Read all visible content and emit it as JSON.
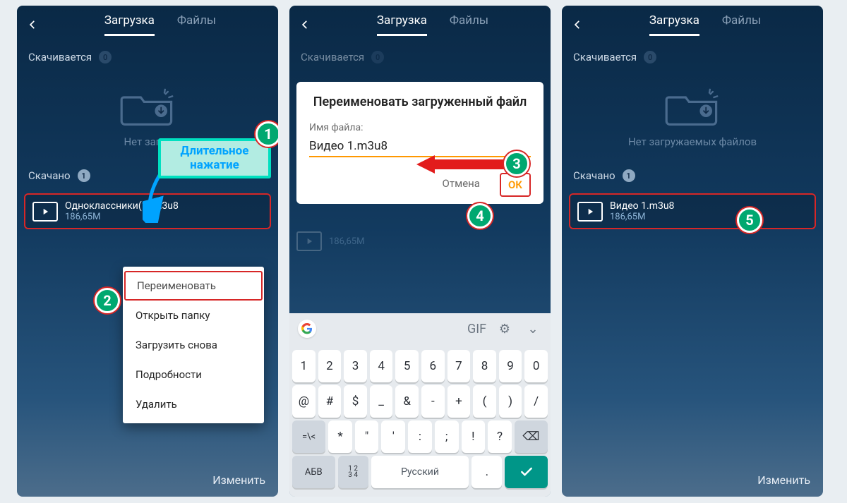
{
  "tabs": {
    "active": "Загрузка",
    "inactive": "Файлы"
  },
  "sections": {
    "downloading": "Скачивается",
    "downloaded": "Скачано"
  },
  "counts": {
    "downloading": "0",
    "downloaded": "1"
  },
  "empty_text_partial": "Нет загру",
  "empty_text_full": "Нет загружаемых файлов",
  "callout": {
    "line1": "Длительное",
    "line2": "нажатие"
  },
  "file_before": {
    "name": "Одноклассники(1).m3u8",
    "size": "186,65M",
    "size_dim": "186,65M"
  },
  "file_after": {
    "name": "Видео 1.m3u8",
    "size": "186,65M"
  },
  "context_menu": [
    "Переименовать",
    "Открыть папку",
    "Загрузить снова",
    "Подробности",
    "Удалить"
  ],
  "dialog": {
    "title": "Переименовать загруженный файл",
    "label": "Имя файла:",
    "value": "Видео 1.m3u8",
    "cancel": "Отмена",
    "ok": "ОК"
  },
  "footer": "Изменить",
  "markers": {
    "m1": "1",
    "m2": "2",
    "m3": "3",
    "m4": "4",
    "m5": "5"
  },
  "keyboard": {
    "row1": [
      "1",
      "2",
      "3",
      "4",
      "5",
      "6",
      "7",
      "8",
      "9",
      "0"
    ],
    "row2": [
      "@",
      "#",
      "$",
      "_",
      "&",
      "-",
      "+",
      "(",
      ")",
      "/"
    ],
    "row3_shift": "=\\<",
    "row3": [
      "*",
      "\"",
      "'",
      ":",
      ";",
      "!",
      "?"
    ],
    "row3_bksp": "⌫",
    "row4_mode": "АБВ",
    "row4_num": "1234",
    "space": "Русский",
    "dot": ".",
    "go": "✓"
  }
}
